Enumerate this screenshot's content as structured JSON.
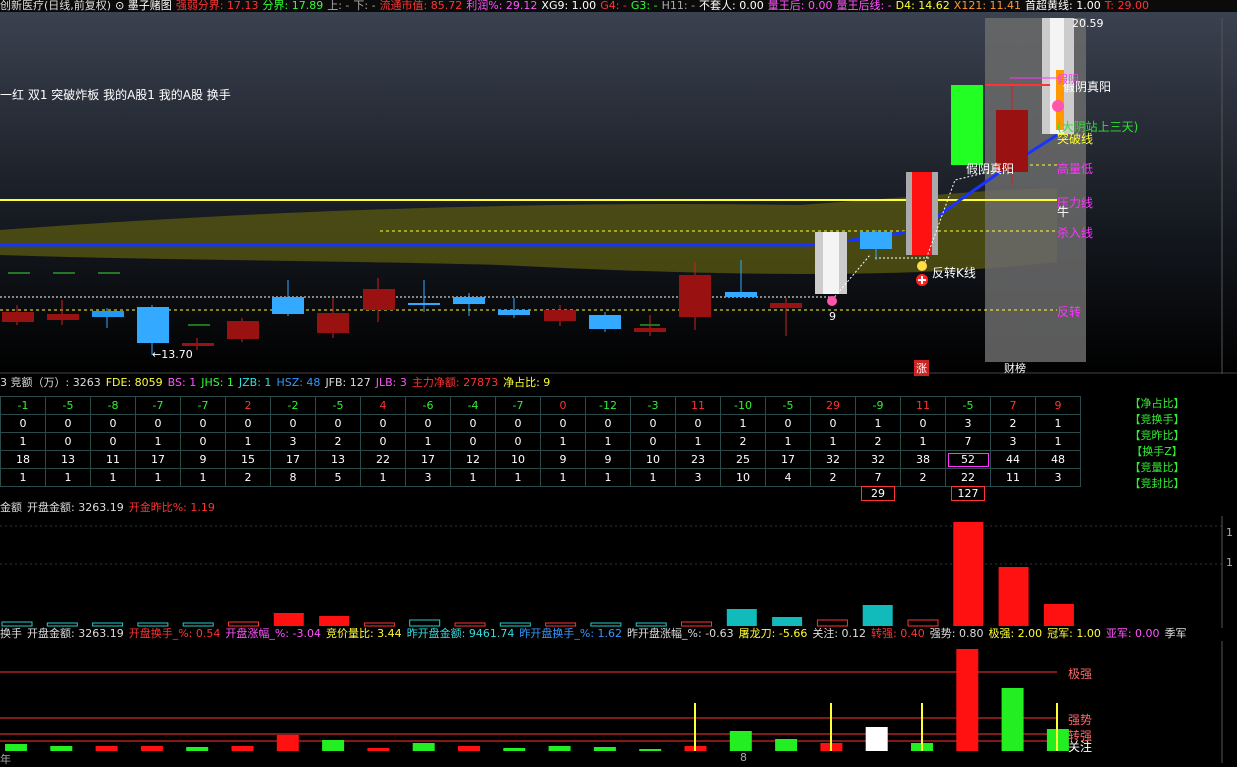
{
  "topbar": [
    {
      "text": "创新医疗(日线,前复权)",
      "color": "#dddddd"
    },
    {
      "text": "⊙ 墨子赌图",
      "color": "#ffffff"
    },
    {
      "text": "强弱分界: 17.13",
      "color": "#ff3333"
    },
    {
      "text": "分界: 17.89",
      "color": "#33ff33"
    },
    {
      "text": "上: -",
      "color": "#aaaaaa"
    },
    {
      "text": "下: -",
      "color": "#aaaaaa"
    },
    {
      "text": "流通市值: 85.72",
      "color": "#ff3333"
    },
    {
      "text": "利润%: 29.12",
      "color": "#ff55ff"
    },
    {
      "text": "XG9: 1.00",
      "color": "#ffffff"
    },
    {
      "text": "G4: -",
      "color": "#ff3333"
    },
    {
      "text": "G3: -",
      "color": "#33ff33"
    },
    {
      "text": "H11: -",
      "color": "#aaaaaa"
    },
    {
      "text": "不套人: 0.00",
      "color": "#ffffff"
    },
    {
      "text": "量王后: 0.00",
      "color": "#ff55ff"
    },
    {
      "text": "量王后线: -",
      "color": "#ff55ff"
    },
    {
      "text": "D4: 14.62",
      "color": "#ffff33"
    },
    {
      "text": "X121: 11.41",
      "color": "#ff9933"
    },
    {
      "text": "首超黄线: 1.00",
      "color": "#ffffff"
    },
    {
      "text": "T: 29.00",
      "color": "#ff3333"
    }
  ],
  "indicator_row": "一红 双1 突破炸板 我的A股1 我的A股 换手",
  "main_labels": {
    "high": "20.59",
    "low": "←13.70",
    "jiayin1": "假阴真阳",
    "jiayin2": "假阴真阳",
    "gujie": "(大阴站上三天)",
    "tupo": "突破线",
    "gaoliang": "高量低",
    "yali": "压力线",
    "niu": "牛",
    "jinru": "杀入线",
    "fanzhuanK": "反转K线",
    "fanzhuan": "反转",
    "nine": "9",
    "zhang": "涨",
    "caibang": "财榜",
    "topright": "假阴"
  },
  "jing_line": [
    {
      "text": "3 竞额（万）: 3263",
      "color": "#dddddd"
    },
    {
      "text": "FDE: 8059",
      "color": "#ffff33"
    },
    {
      "text": "BS: 1",
      "color": "#ff55ff"
    },
    {
      "text": "JHS: 1",
      "color": "#33ff33"
    },
    {
      "text": "JZB: 1",
      "color": "#33dddd"
    },
    {
      "text": "HSZ: 48",
      "color": "#3399ff"
    },
    {
      "text": "JFB: 127",
      "color": "#dddddd"
    },
    {
      "text": "JLB: 3",
      "color": "#ff55ff"
    },
    {
      "text": "主力净额: 27873",
      "color": "#ff3333"
    },
    {
      "text": "净占比: 9",
      "color": "#ffff33"
    }
  ],
  "table": {
    "rows": [
      [
        "-1",
        "-5",
        "-8",
        "-7",
        "-7",
        "2",
        "-2",
        "-5",
        "4",
        "-6",
        "-4",
        "-7",
        "0",
        "-12",
        "-3",
        "11",
        "-10",
        "-5",
        "29",
        "-9",
        "11",
        "-5",
        "7",
        "9"
      ],
      [
        "0",
        "0",
        "0",
        "0",
        "0",
        "0",
        "0",
        "0",
        "0",
        "0",
        "0",
        "0",
        "0",
        "0",
        "0",
        "0",
        "1",
        "0",
        "0",
        "1",
        "0",
        "3",
        "2",
        "1"
      ],
      [
        "1",
        "0",
        "0",
        "1",
        "0",
        "1",
        "3",
        "2",
        "0",
        "1",
        "0",
        "0",
        "1",
        "1",
        "0",
        "1",
        "2",
        "1",
        "1",
        "2",
        "1",
        "7",
        "3",
        "1"
      ],
      [
        "18",
        "13",
        "11",
        "17",
        "9",
        "15",
        "17",
        "13",
        "22",
        "17",
        "12",
        "10",
        "9",
        "9",
        "10",
        "23",
        "25",
        "17",
        "32",
        "32",
        "38",
        "52",
        "44",
        "48"
      ],
      [
        "1",
        "1",
        "1",
        "1",
        "1",
        "2",
        "8",
        "5",
        "1",
        "3",
        "1",
        "1",
        "1",
        "1",
        "1",
        "3",
        "10",
        "4",
        "2",
        "7",
        "2",
        "22",
        "11",
        "3"
      ]
    ],
    "below_left": "29",
    "below_right": "127",
    "side_labels": [
      "【净占比】",
      "【竞换手】",
      "【竞昨比】",
      "【换手Z】",
      "【竞量比】",
      "【竞封比】"
    ]
  },
  "vol_line": [
    {
      "text": "金额",
      "color": "#dddddd"
    },
    {
      "text": "开盘金额: 3263.19",
      "color": "#dddddd"
    },
    {
      "text": "开金昨比%: 1.19",
      "color": "#ff3333"
    }
  ],
  "vol_axis": [
    "1",
    "1"
  ],
  "turn_line": [
    {
      "text": "换手",
      "color": "#dddddd"
    },
    {
      "text": "开盘金额: 3263.19",
      "color": "#dddddd"
    },
    {
      "text": "开盘换手_%: 0.54",
      "color": "#ff3333"
    },
    {
      "text": "开盘涨幅_%: -3.04",
      "color": "#ff55ff"
    },
    {
      "text": "竞价量比: 3.44",
      "color": "#ffff33"
    },
    {
      "text": "昨开盘金额: 9461.74",
      "color": "#33dddd"
    },
    {
      "text": "昨开盘换手_%: 1.62",
      "color": "#3399ff"
    },
    {
      "text": "昨开盘涨幅_%: -0.63",
      "color": "#dddddd"
    },
    {
      "text": "屠龙刀: -5.66",
      "color": "#ffff33"
    },
    {
      "text": "关注: 0.12",
      "color": "#dddddd"
    },
    {
      "text": "转强: 0.40",
      "color": "#ff3333"
    },
    {
      "text": "强势: 0.80",
      "color": "#dddddd"
    },
    {
      "text": "极强: 2.00",
      "color": "#ffff33"
    },
    {
      "text": "冠军: 1.00",
      "color": "#ffff33"
    },
    {
      "text": "亚军: 0.00",
      "color": "#ff55ff"
    },
    {
      "text": "季军",
      "color": "#dddddd"
    }
  ],
  "turn_labels": {
    "jiqiang": "极强",
    "qiangshi": "强势",
    "zhuanqiang": "转强",
    "guanzhu": "关注"
  },
  "bottom_axis": {
    "left": "年",
    "mid": "8"
  }
}
